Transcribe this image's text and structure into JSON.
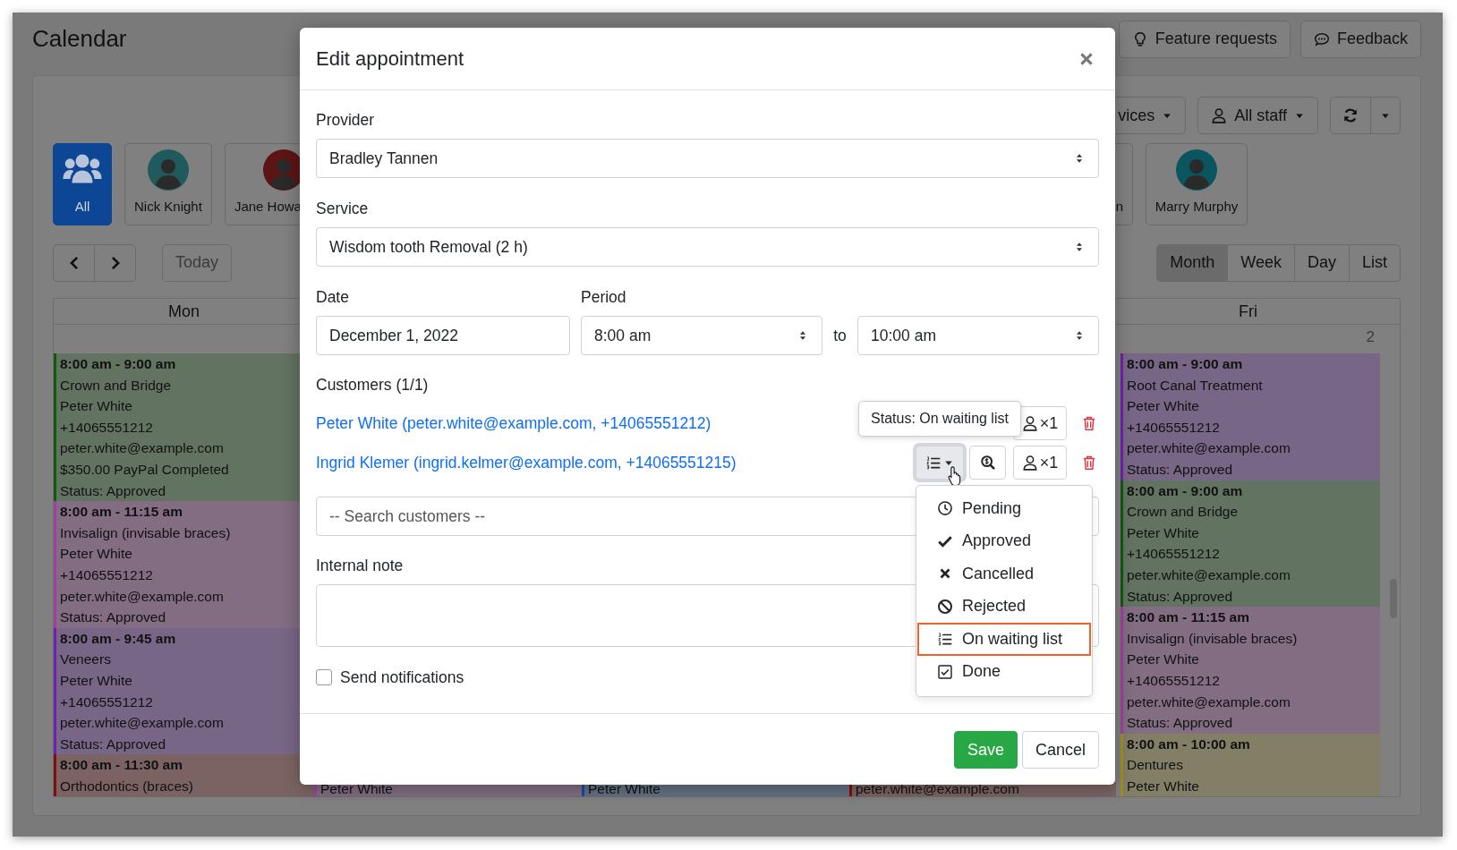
{
  "page": {
    "title": "Calendar",
    "header_buttons": [
      {
        "kind": "bulb",
        "label": "Feature requests"
      },
      {
        "kind": "chat",
        "label": "Feedback"
      }
    ]
  },
  "toolbar": {
    "services": "vices",
    "staff_filter": "All staff"
  },
  "staff": [
    {
      "kind": "group",
      "name": "All",
      "selected": true
    },
    {
      "kind": "avatar",
      "name": "Nick Knight",
      "selected": false,
      "color": "#1f5a5c"
    },
    {
      "kind": "avatar",
      "name": "Jane Howa",
      "selected": false,
      "color": "#5c1414"
    },
    {
      "kind": "text",
      "name": "n",
      "selected": false
    },
    {
      "kind": "avatar",
      "name": "Marry Murphy",
      "selected": false,
      "color": "#0a5560"
    }
  ],
  "nav": {
    "today": "Today"
  },
  "views": [
    {
      "label": "Month",
      "selected": true
    },
    {
      "label": "Week",
      "selected": false
    },
    {
      "label": "Day",
      "selected": false
    },
    {
      "label": "List",
      "selected": false
    }
  ],
  "calendar": {
    "columns": [
      {
        "label": "Mon",
        "events": [
          {
            "color": "#0f5a0f",
            "time": "8:00 am - 9:00 am",
            "lines": [
              "Crown and Bridge",
              "Peter White",
              "+14065551212",
              "peter.white@example.com",
              "$350.00 PayPal Completed",
              "Status: Approved"
            ]
          },
          {
            "color": "#a040a0",
            "time": "8:00 am - 11:15 am",
            "lines": [
              "Invisalign (invisable braces)",
              "Peter White",
              "+14065551212",
              "peter.white@example.com",
              "Status: Approved"
            ]
          },
          {
            "color": "#7020b0",
            "time": "8:00 am - 9:45 am",
            "lines": [
              "Veneers",
              "Peter White",
              "+14065551212",
              "peter.white@example.com",
              "Status: Approved"
            ]
          },
          {
            "color": "#801010",
            "time": "8:00 am - 11:30 am",
            "lines": [
              "Orthodontics (braces)"
            ]
          }
        ]
      },
      {
        "events": [
          {
            "color": "#a040a0",
            "lines": [
              "Peter White"
            ]
          }
        ]
      },
      {
        "events": [
          {
            "color": "#1050a0",
            "lines": [
              "Peter White"
            ]
          }
        ]
      },
      {
        "events": [
          {
            "color": "#801010",
            "lines": [
              "peter.white@example.com"
            ]
          }
        ]
      },
      {
        "label": "Fri",
        "date": "2",
        "events": [
          {
            "color": "#7020b0",
            "time": "8:00 am - 9:00 am",
            "lines": [
              "Root Canal Treatment",
              "Peter White",
              "+14065551212",
              "peter.white@example.com",
              "Status: Approved"
            ]
          },
          {
            "color": "#0f5a0f",
            "time": "8:00 am - 9:00 am",
            "lines": [
              "Crown and Bridge",
              "Peter White",
              "+14065551212",
              "peter.white@example.com",
              "Status: Approved"
            ]
          },
          {
            "color": "#a040a0",
            "time": "8:00 am - 11:15 am",
            "lines": [
              "Invisalign (invisable braces)",
              "Peter White",
              "+14065551212",
              "peter.white@example.com",
              "Status: Approved"
            ]
          },
          {
            "color": "#a09020",
            "time": "8:00 am - 10:00 am",
            "lines": [
              "Dentures",
              "Peter White"
            ]
          }
        ]
      }
    ]
  },
  "modal": {
    "title": "Edit appointment",
    "provider": {
      "label": "Provider",
      "value": "Bradley Tannen"
    },
    "service": {
      "label": "Service",
      "value": "Wisdom tooth Removal (2 h)"
    },
    "date": {
      "label": "Date",
      "value": "December 1, 2022"
    },
    "period": {
      "label": "Period",
      "start": "8:00 am",
      "separator": "to",
      "end": "10:00 am"
    },
    "customers": {
      "label": "Customers (1/1)",
      "items": [
        {
          "text": "Peter White (peter.white@example.com, +14065551212)",
          "count": "×1",
          "covered_by_tooltip": true,
          "menu_open": false
        },
        {
          "text": "Ingrid Klemer (ingrid.kelmer@example.com, +14065551215)",
          "count": "×1",
          "covered_by_tooltip": false,
          "menu_open": true
        }
      ]
    },
    "tooltip": "Status: On waiting list",
    "status_menu": [
      {
        "kind": "clock",
        "label": "Pending",
        "selected": false
      },
      {
        "kind": "check",
        "label": "Approved",
        "selected": false
      },
      {
        "kind": "cross",
        "label": "Cancelled",
        "selected": false
      },
      {
        "kind": "ban",
        "label": "Rejected",
        "selected": false
      },
      {
        "kind": "list",
        "label": "On waiting list",
        "selected": true
      },
      {
        "kind": "done",
        "label": "Done",
        "selected": false
      }
    ],
    "search": {
      "placeholder": "-- Search customers --"
    },
    "note": {
      "label": "Internal note"
    },
    "notifications": {
      "label": "Send notifications",
      "checked": false
    },
    "buttons": [
      {
        "kind": "primary",
        "label": "Save"
      },
      {
        "kind": "secondary",
        "label": "Cancel"
      }
    ]
  }
}
